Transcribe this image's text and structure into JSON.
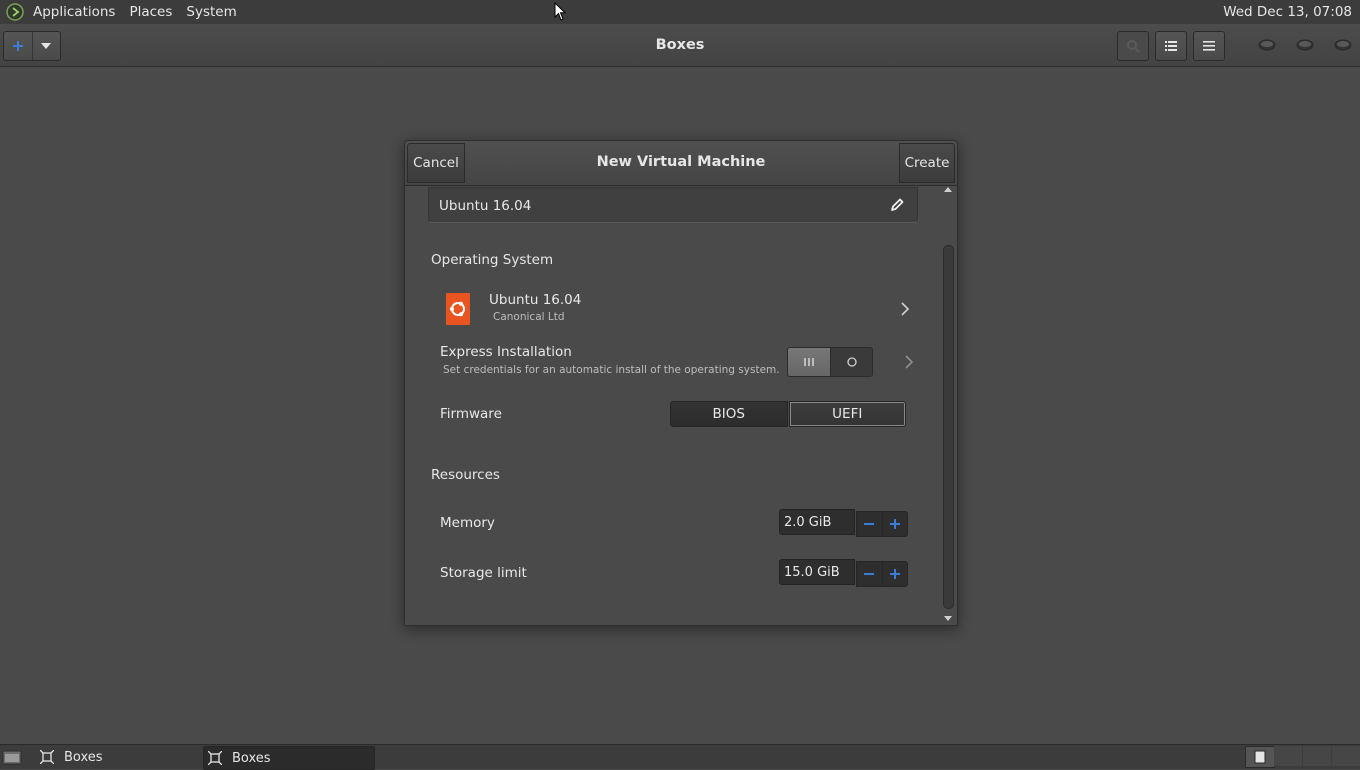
{
  "top_panel": {
    "menu": [
      "Applications",
      "Places",
      "System"
    ],
    "clock": "Wed Dec 13, 07:08"
  },
  "app": {
    "title": "Boxes"
  },
  "dialog": {
    "title": "New Virtual Machine",
    "cancel_label": "Cancel",
    "create_label": "Create",
    "vm_name": "Ubuntu 16.04",
    "os_section": "Operating System",
    "os": {
      "name": "Ubuntu 16.04",
      "vendor": "Canonical Ltd"
    },
    "express": {
      "label": "Express Installation",
      "description": "Set credentials for an automatic install of the operating system.",
      "enabled": false
    },
    "firmware": {
      "label": "Firmware",
      "options": [
        "BIOS",
        "UEFI"
      ],
      "selected": "UEFI"
    },
    "resources_section": "Resources",
    "memory": {
      "label": "Memory",
      "value": "2.0 GiB"
    },
    "storage": {
      "label": "Storage limit",
      "value": "15.0 GiB"
    }
  },
  "taskbar": {
    "tasks": [
      "Boxes",
      "Boxes"
    ]
  },
  "colors": {
    "accent": "#3a7dd9",
    "ubuntu_orange": "#e95420",
    "background": "#4a4a4a"
  }
}
